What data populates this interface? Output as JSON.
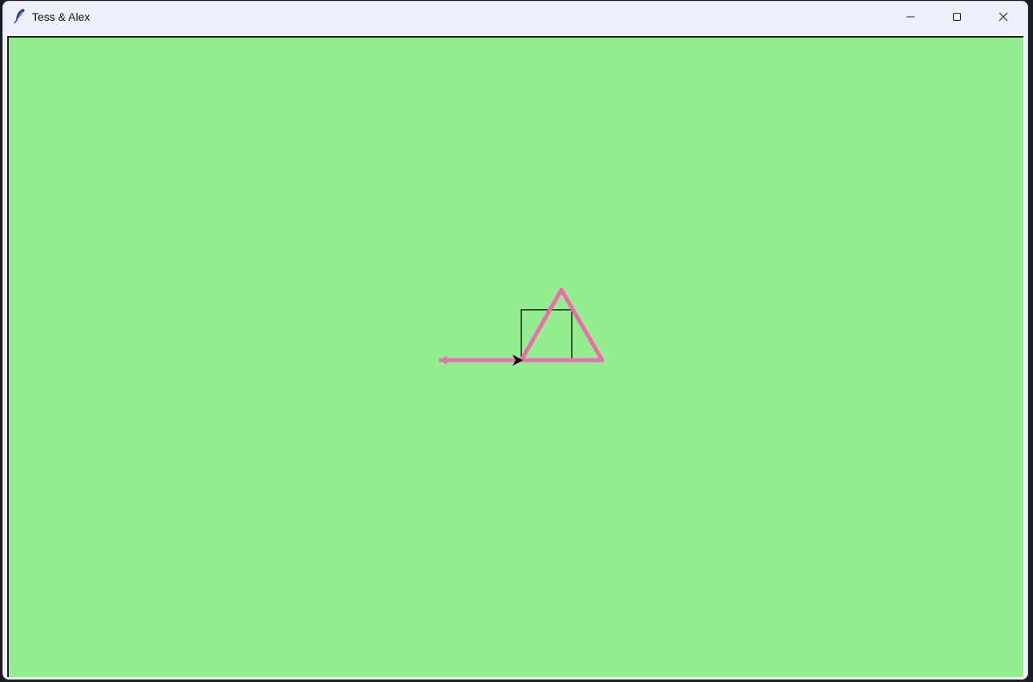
{
  "window": {
    "title": "Tess & Alex",
    "icon": "feather-icon",
    "controls": {
      "minimize": "minimize-icon",
      "maximize": "maximize-icon",
      "close": "close-icon"
    }
  },
  "canvas": {
    "background_color": "#93ee90",
    "drawing": {
      "pen_color": "#f06aae",
      "shapes": [
        "triangle",
        "square",
        "line",
        "turtle-cursor"
      ],
      "square_color": "#000000",
      "turtle_color": "#000000"
    }
  }
}
